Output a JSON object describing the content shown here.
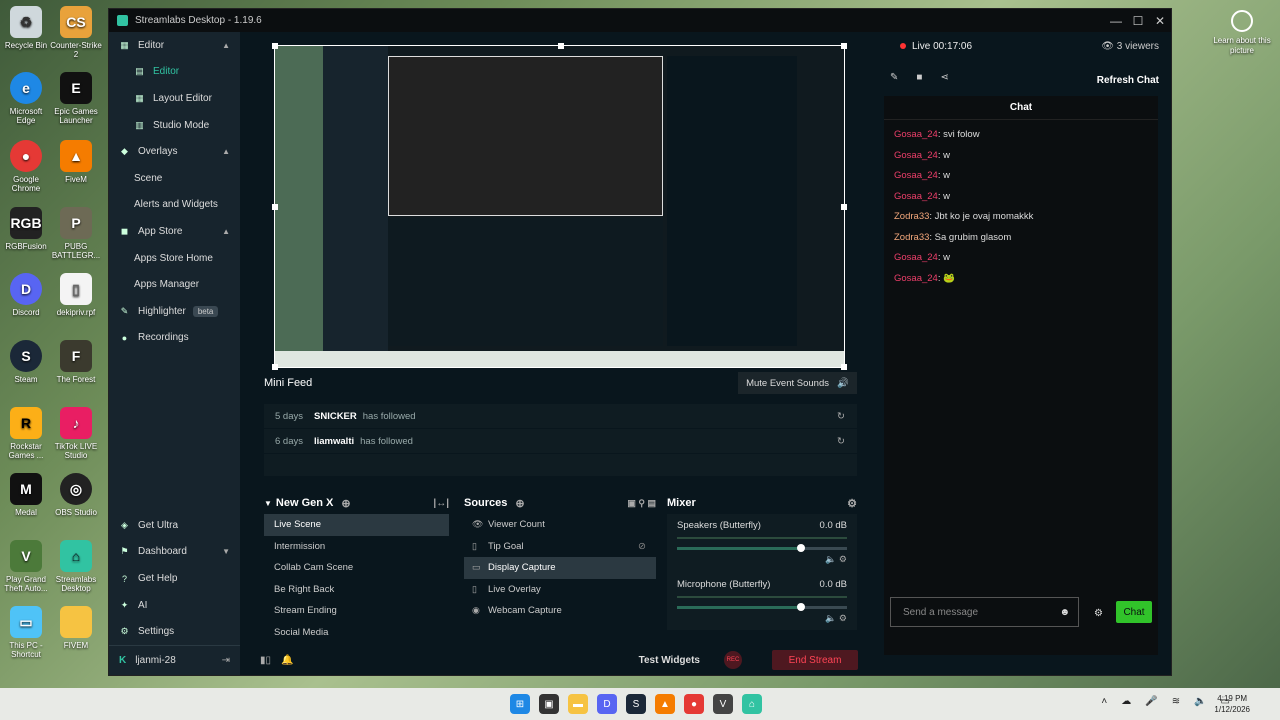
{
  "desktop": {
    "icons": [
      {
        "label": "Recycle Bin",
        "icon": "recycle-bin-icon"
      },
      {
        "label": "Counter-Strike 2",
        "icon": "cs2-icon"
      },
      {
        "label": "Microsoft Edge",
        "icon": "edge-icon"
      },
      {
        "label": "Epic Games Launcher",
        "icon": "epic-icon"
      },
      {
        "label": "Google Chrome",
        "icon": "chrome-icon"
      },
      {
        "label": "FiveM",
        "icon": "fivem-icon"
      },
      {
        "label": "RGBFusion",
        "icon": "rgbfusion-icon"
      },
      {
        "label": "PUBG BATTLEGR...",
        "icon": "pubg-icon"
      },
      {
        "label": "Discord",
        "icon": "discord-icon"
      },
      {
        "label": "dekipriv.rpf",
        "icon": "file-icon"
      },
      {
        "label": "Steam",
        "icon": "steam-icon"
      },
      {
        "label": "The Forest",
        "icon": "forest-icon"
      },
      {
        "label": "Rockstar Games ...",
        "icon": "rockstar-icon"
      },
      {
        "label": "TikTok LIVE Studio",
        "icon": "tiktok-icon"
      },
      {
        "label": "Medal",
        "icon": "medal-icon"
      },
      {
        "label": "OBS Studio",
        "icon": "obs-icon"
      },
      {
        "label": "Play Grand Theft Auto...",
        "icon": "gta-icon"
      },
      {
        "label": "Streamlabs Desktop",
        "icon": "streamlabs-icon"
      },
      {
        "label": "This PC - Shortcut",
        "icon": "pc-icon"
      },
      {
        "label": "FIVEM",
        "icon": "folder-icon"
      }
    ],
    "learn": "Learn about this picture"
  },
  "window": {
    "title": "Streamlabs Desktop - 1.19.6"
  },
  "sidebar": {
    "editor": "Editor",
    "editor_sub": "Editor",
    "layout_editor": "Layout Editor",
    "studio_mode": "Studio Mode",
    "overlays": "Overlays",
    "scene": "Scene",
    "alerts": "Alerts and Widgets",
    "app_store": "App Store",
    "apps_home": "Apps Store Home",
    "apps_manager": "Apps Manager",
    "highlighter": "Highlighter",
    "beta": "beta",
    "recordings": "Recordings",
    "get_ultra": "Get Ultra",
    "dashboard": "Dashboard",
    "get_help": "Get Help",
    "ai": "AI",
    "settings": "Settings",
    "user": "ljanmi-28"
  },
  "minifeed": {
    "title": "Mini Feed",
    "mute": "Mute Event Sounds",
    "items": [
      {
        "time": "5 days",
        "name": "SNICKER",
        "action": "has followed"
      },
      {
        "time": "6 days",
        "name": "liamwalti",
        "action": "has followed"
      }
    ]
  },
  "scenes": {
    "title": "New Gen X",
    "items": [
      "Live Scene",
      "Intermission",
      "Collab Cam Scene",
      "Be Right Back",
      "Stream Ending",
      "Social Media"
    ]
  },
  "sources": {
    "title": "Sources",
    "items": [
      "Viewer Count",
      "Tip Goal",
      "Display Capture",
      "Live Overlay",
      "Webcam Capture"
    ]
  },
  "mixer": {
    "title": "Mixer",
    "channels": [
      {
        "name": "Speakers (Butterfly)",
        "db": "0.0 dB"
      },
      {
        "name": "Microphone (Butterfly)",
        "db": "0.0 dB"
      }
    ]
  },
  "footer": {
    "test_widgets": "Test Widgets",
    "rec": "REC",
    "end_stream": "End Stream"
  },
  "chat": {
    "live": "Live 00:17:06",
    "viewers": "3 viewers",
    "refresh": "Refresh Chat",
    "title": "Chat",
    "messages": [
      {
        "user": "Gosaa_24",
        "text": "svi folow"
      },
      {
        "user": "Gosaa_24",
        "text": "w"
      },
      {
        "user": "Gosaa_24",
        "text": "w"
      },
      {
        "user": "Gosaa_24",
        "text": "w"
      },
      {
        "user": "Zodra33",
        "text": "Jbt ko je ovaj momakkk"
      },
      {
        "user": "Zodra33",
        "text": "Sa grubim glasom"
      },
      {
        "user": "Gosaa_24",
        "text": "w"
      },
      {
        "user": "Gosaa_24",
        "text": "🐸"
      }
    ],
    "placeholder": "Send a message",
    "send": "Chat"
  },
  "taskbar": {
    "time": "4:19 PM",
    "date": "1/12/2026"
  }
}
